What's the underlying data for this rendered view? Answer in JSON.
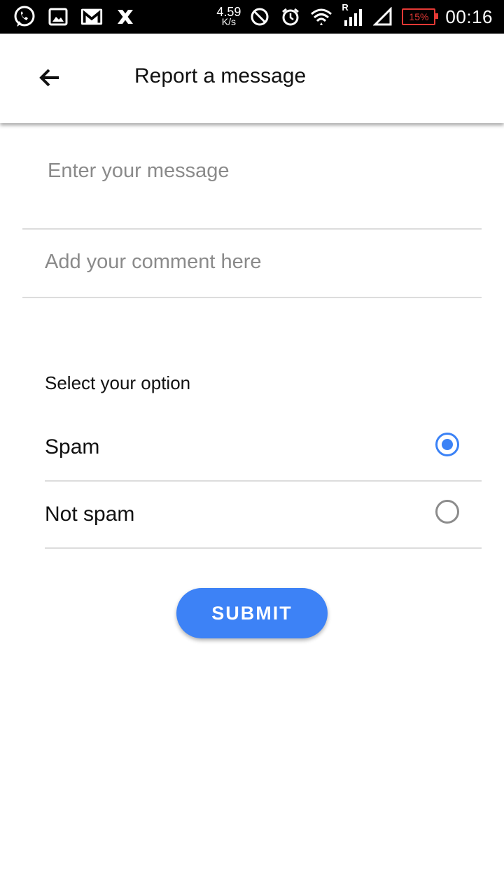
{
  "status_bar": {
    "left_icons": [
      "whatsapp-icon",
      "gallery-icon",
      "gmail-icon",
      "x-app-icon"
    ],
    "net_speed_value": "4.59",
    "net_speed_unit": "K/s",
    "roaming_marker": "R",
    "battery_percent": "15%",
    "battery_color": "#e53935",
    "time": "00:16"
  },
  "app_bar": {
    "back_icon": "arrow-left-icon",
    "title": "Report a message"
  },
  "form": {
    "message_placeholder": "Enter your message",
    "comment_placeholder": "Add your comment here",
    "option_label": "Select your option",
    "options": [
      {
        "label": "Spam",
        "selected": true
      },
      {
        "label": "Not spam",
        "selected": false
      }
    ],
    "submit_label": "SUBMIT"
  },
  "colors": {
    "accent": "#3d82f6",
    "divider": "#dcdcdc",
    "radio_unselected": "#8c8c8c"
  }
}
